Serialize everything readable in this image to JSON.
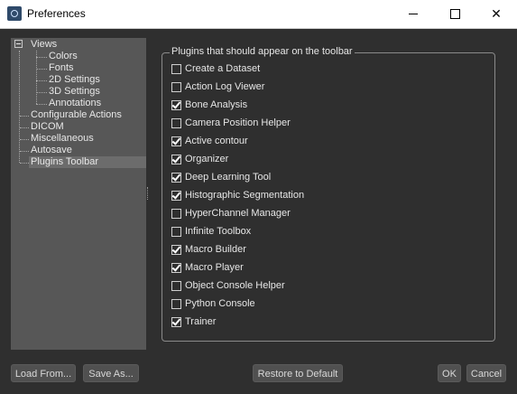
{
  "window": {
    "title": "Preferences",
    "minimize_icon": "minimize-icon",
    "maximize_icon": "maximize-icon",
    "close_icon": "close-icon",
    "close_glyph": "✕"
  },
  "nav": {
    "items": [
      {
        "label": "Views"
      },
      {
        "label": "Colors"
      },
      {
        "label": "Fonts"
      },
      {
        "label": "2D Settings"
      },
      {
        "label": "3D Settings"
      },
      {
        "label": "Annotations"
      },
      {
        "label": "Configurable Actions"
      },
      {
        "label": "DICOM"
      },
      {
        "label": "Miscellaneous"
      },
      {
        "label": "Autosave"
      },
      {
        "label": "Plugins Toolbar"
      }
    ],
    "selected": "Plugins Toolbar"
  },
  "plugins": {
    "group_title": "Plugins that should appear on the toolbar",
    "items": [
      {
        "label": "Create a Dataset",
        "checked": false
      },
      {
        "label": "Action Log Viewer",
        "checked": false
      },
      {
        "label": "Bone Analysis",
        "checked": true
      },
      {
        "label": "Camera Position Helper",
        "checked": false
      },
      {
        "label": "Active contour",
        "checked": true
      },
      {
        "label": "Organizer",
        "checked": true
      },
      {
        "label": "Deep Learning Tool",
        "checked": true
      },
      {
        "label": "Histographic Segmentation",
        "checked": true
      },
      {
        "label": "HyperChannel Manager",
        "checked": false
      },
      {
        "label": "Infinite Toolbox",
        "checked": false
      },
      {
        "label": "Macro Builder",
        "checked": true
      },
      {
        "label": "Macro Player",
        "checked": true
      },
      {
        "label": "Object Console Helper",
        "checked": false
      },
      {
        "label": "Python Console",
        "checked": false
      },
      {
        "label": "Trainer",
        "checked": true
      }
    ]
  },
  "buttons": {
    "load_from": "Load From...",
    "save_as": "Save As...",
    "restore_default": "Restore to Default",
    "ok": "OK",
    "cancel": "Cancel"
  }
}
